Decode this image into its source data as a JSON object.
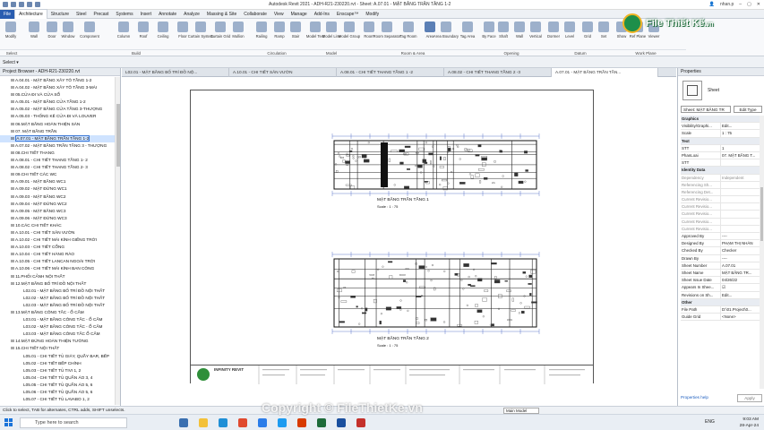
{
  "window": {
    "title": "Autodesk Revit 2021 - ADH-R21-230220.rvt - Sheet: A.07.01 - MẶT BẰNG TRẦN TẦNG 1-2",
    "user": "nhan.p"
  },
  "menu": [
    "File",
    "Architecture",
    "Structure",
    "Steel",
    "Precast",
    "Systems",
    "Insert",
    "Annotate",
    "Analyze",
    "Massing & Site",
    "Collaborate",
    "View",
    "Manage",
    "Add-Ins",
    "Enscape™",
    "Modify"
  ],
  "ribbon": {
    "buttons": [
      "Modify",
      "Wall",
      "Door",
      "Window",
      "Component",
      "Column",
      "Roof",
      "Ceiling",
      "Floor",
      "Curtain System",
      "Curtain Grid",
      "Mullion",
      "Railing",
      "Ramp",
      "Stair",
      "Model Text",
      "Model Line",
      "Model Group",
      "Room",
      "Room Separator",
      "Tag Room",
      "Area",
      "Area Boundary",
      "Tag Area",
      "By Face",
      "Shaft",
      "Wall",
      "Vertical",
      "Dormer",
      "Level",
      "Grid",
      "Set",
      "Show",
      "Ref Plane",
      "Viewer"
    ],
    "panels": [
      "Select",
      "Build",
      "Circulation",
      "Model",
      "Room & Area",
      "Opening",
      "Datum",
      "Work Plane"
    ]
  },
  "select_label": "Select ▾",
  "project_browser": {
    "title": "Project Browser - ADH-R21-230220.rvt",
    "items": [
      "A.04.01 - MẶT BẰNG XÂY TÔ TẦNG 1-2",
      "A.04.02 - MẶT BẰNG XÂY TÔ TẦNG 3-MÁI",
      "05.CỬA ĐI VÀ CỬA SỔ",
      "A.05.01 - MẶT BẰNG CỬA TẦNG 1-2",
      "A.05.02 - MẶT BẰNG CỬA TẦNG 3-THƯỢNG",
      "A.05.03 - THỐNG KÊ CỬA ĐI VÀ LOUVER",
      "06.MẶT BẰNG HOÀN THIỆN SÀN",
      "07. MẶT BẰNG TRẦN",
      "A.07.01 - MẶT BẰNG TRẦN TẦNG 1-2",
      "A.07.02 - MẶT BẰNG TRẦN TẦNG 3 - THƯỢNG",
      "08.CHI TIẾT THANG",
      "A.08.01 - CHI TIẾT THANG TẦNG 1- 2",
      "A.08.02 - CHI TIẾT THANG TẦNG 2- 3",
      "09.CHI TIẾT CÁC WC",
      "A.09.01 - MẶT BẰNG WC1",
      "A.09.02 - MẶT ĐỨNG WC1",
      "A.09.03 - MẶT BẰNG WC2",
      "A.09.04 - MẶT ĐỨNG WC2",
      "A.09.05 - MẶT BẰNG WC3",
      "A.09.06 - MẶT ĐỨNG WC3",
      "10.CÁC CHI TIẾT KHÁC",
      "A.10.01 - CHI TIẾT SÂN VƯỜN",
      "A.10.02 - CHI TIẾT MÁI KÍNH GIẾNG TRỜI",
      "A.10.03 - CHI TIẾT CỔNG",
      "A.10.04 - CHI TIẾT HÀNG RÀO",
      "A.10.05 - CHI TIẾT LANCAN NGOÀI TRỜI",
      "A.10.06 - CHI TIẾT MÁI KÍNH BAN CÔNG",
      "11.PHỐI CẢNH NỘI THẤT",
      "12.MẶT BẰNG BỐ TRÍ ĐỒ NỘI THẤT",
      "L02.01 - MẶT BẰNG BỐ TRÍ ĐỒ NỘI THẤT",
      "L02.02 - MẶT BẰNG BỐ TRÍ ĐỒ NỘI THẤT",
      "L02.03 - MẶT BẰNG BỐ TRÍ ĐỒ NỘI THẤT",
      "13.MẶT BẰNG CÔNG TẮC - Ổ CẮM",
      "L03.01 - MẶT BẰNG CÔNG TẮC - Ổ CẮM",
      "L03.02 - MẶT BẰNG CÔNG TẮC - Ổ CẮM",
      "L03.03 - MẶT BẰNG CÔNG TẮC Ổ CẮM",
      "14.MẶT ĐỨNG HOÀN THIỆN TƯỜNG",
      "15.CHI TIẾT NỘI THẤT",
      "L05.01 - CHI TIẾT TỦ GIÀY, QUẦY BAR, BẾP",
      "L05.02 - CHI TIẾT BẾP CHÍNH",
      "L05.03 - CHI TIẾT TỦ TIVI 1, 2",
      "L05.04 - CHI TIẾT TỦ QUẦN ÁO 3, 4",
      "L05.05 - CHI TIẾT TỦ QUẦN ÁO 5, 6",
      "L05.06 - CHI TIẾT TỦ QUẦN ÁO 5, 6",
      "L05.07 - CHI TIẾT TỦ LAVABO 1, 2"
    ]
  },
  "tabs": [
    "L02.01 - MẶT BẰNG BỐ TRÍ ĐỒ NỘ...",
    "A.10.01 - CHI TIẾT SÂN VƯỜN",
    "A.08.01 - CHI TIẾT THANG TẦNG 1 -2",
    "A.08.02 - CHI TIẾT THANG TẦNG 2 -3",
    "A.07.01 - MẶT BẰNG TRẦN TẦN..."
  ],
  "sheet": {
    "plan1_title": "MẶT BẰNG TRẦN TẦNG 1",
    "plan2_title": "MẶT BẰNG TRẦN TẦNG 2",
    "scale": "Scale : 1 : 75",
    "company": "INFINITY REVIT"
  },
  "properties": {
    "title": "Properties",
    "type": "Sheet",
    "selector": "Sheet: MẶT BẰNG TR",
    "edit_type": "Edit Type",
    "rows": [
      {
        "k": "Graphics",
        "v": "",
        "grp": true
      },
      {
        "k": "Visibility/Graphi...",
        "v": "Edit..."
      },
      {
        "k": "Scale",
        "v": "1 : 75"
      },
      {
        "k": "Text",
        "v": "",
        "grp": true
      },
      {
        "k": "STT",
        "v": "1"
      },
      {
        "k": "PhanLoai",
        "v": "07. MẶT BẰNG T..."
      },
      {
        "k": "STT",
        "v": ""
      },
      {
        "k": "Identity Data",
        "v": "",
        "grp": true
      },
      {
        "k": "Dependency",
        "v": "Independent",
        "dim": true
      },
      {
        "k": "Referencing Sh...",
        "v": "",
        "dim": true
      },
      {
        "k": "Referencing Det...",
        "v": "",
        "dim": true
      },
      {
        "k": "Current Revisio...",
        "v": "",
        "dim": true
      },
      {
        "k": "Current Revisio...",
        "v": "",
        "dim": true
      },
      {
        "k": "Current Revisio...",
        "v": "",
        "dim": true
      },
      {
        "k": "Current Revisio...",
        "v": "",
        "dim": true
      },
      {
        "k": "Current Revisio...",
        "v": "",
        "dim": true
      },
      {
        "k": "Approved By",
        "v": "----"
      },
      {
        "k": "Designed By",
        "v": "PHẠM THỊ NHÀN"
      },
      {
        "k": "Checked By",
        "v": "Checker"
      },
      {
        "k": "Drawn By",
        "v": "----"
      },
      {
        "k": "Sheet Number",
        "v": "A.07.01"
      },
      {
        "k": "Sheet Name",
        "v": "MẶT BẰNG TR..."
      },
      {
        "k": "Sheet Issue Date",
        "v": "04/26/22"
      },
      {
        "k": "Appears In Shee...",
        "v": "☑"
      },
      {
        "k": "Revisions on Sh...",
        "v": "Edit..."
      },
      {
        "k": "Other",
        "v": "",
        "grp": true
      },
      {
        "k": "File Path",
        "v": "D:\\01.Project\\0..."
      },
      {
        "k": "Guide Grid",
        "v": "<None>"
      }
    ],
    "help": "Properties help",
    "apply": "Apply"
  },
  "status": {
    "text": "Click to select, TAB for alternates, CTRL adds, SHIFT unselects.",
    "model": "Main Model"
  },
  "taskbar": {
    "search": "Type here to search",
    "lang": "ENG",
    "time": "9:03 AM",
    "date": "28-Apr-24"
  },
  "branding": {
    "logo": "File Thiết Kế",
    "logo_suffix": ".vn",
    "watermark": "Copyright © FileThietKe.vn"
  }
}
